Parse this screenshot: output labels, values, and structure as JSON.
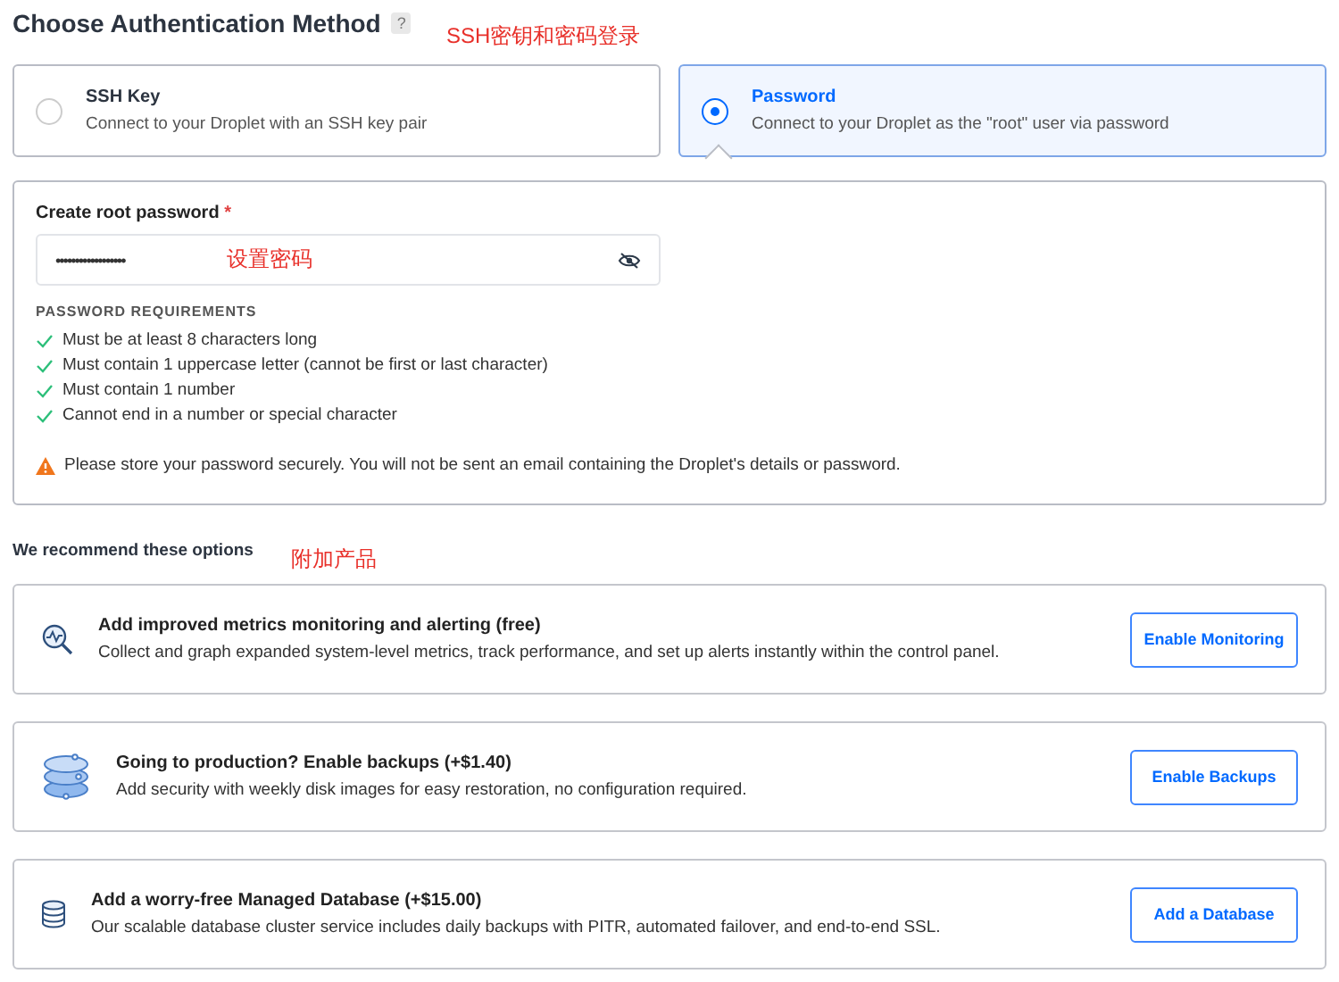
{
  "header": {
    "title": "Choose Authentication Method",
    "help": "?",
    "annotation": "SSH密钥和密码登录"
  },
  "auth_options": [
    {
      "title": "SSH Key",
      "description": "Connect to your Droplet with an SSH key pair",
      "selected": false
    },
    {
      "title": "Password",
      "description": "Connect to your Droplet as the \"root\" user via password",
      "selected": true
    }
  ],
  "password_panel": {
    "label": "Create root password",
    "required": "*",
    "value": "••••••••••••••••••",
    "annotation": "设置密码",
    "requirements_title": "PASSWORD REQUIREMENTS",
    "requirements": [
      {
        "text": "Must be at least 8 characters long",
        "met": true
      },
      {
        "text": "Must contain 1 uppercase letter (cannot be first or last character)",
        "met": true
      },
      {
        "text": "Must contain 1 number",
        "met": true
      },
      {
        "text": "Cannot end in a number or special character",
        "met": true
      }
    ],
    "warning": "Please store your password securely. You will not be sent an email containing the Droplet's details or password."
  },
  "recommend": {
    "title": "We recommend these options",
    "annotation": "附加产品",
    "options": [
      {
        "kind": "monitoring",
        "title": "Add improved metrics monitoring and alerting (free)",
        "description": "Collect and graph expanded system-level metrics, track performance, and set up alerts instantly within the control panel.",
        "button": "Enable Monitoring"
      },
      {
        "kind": "backups",
        "title": "Going to production? Enable backups (+$1.40)",
        "description": "Add security with weekly disk images for easy restoration, no configuration required.",
        "button": "Enable Backups"
      },
      {
        "kind": "database",
        "title": "Add a worry-free Managed Database (+$15.00)",
        "description": "Our scalable database cluster service includes daily backups with PITR, automated failover, and end-to-end SSL.",
        "button": "Add a Database"
      }
    ]
  }
}
